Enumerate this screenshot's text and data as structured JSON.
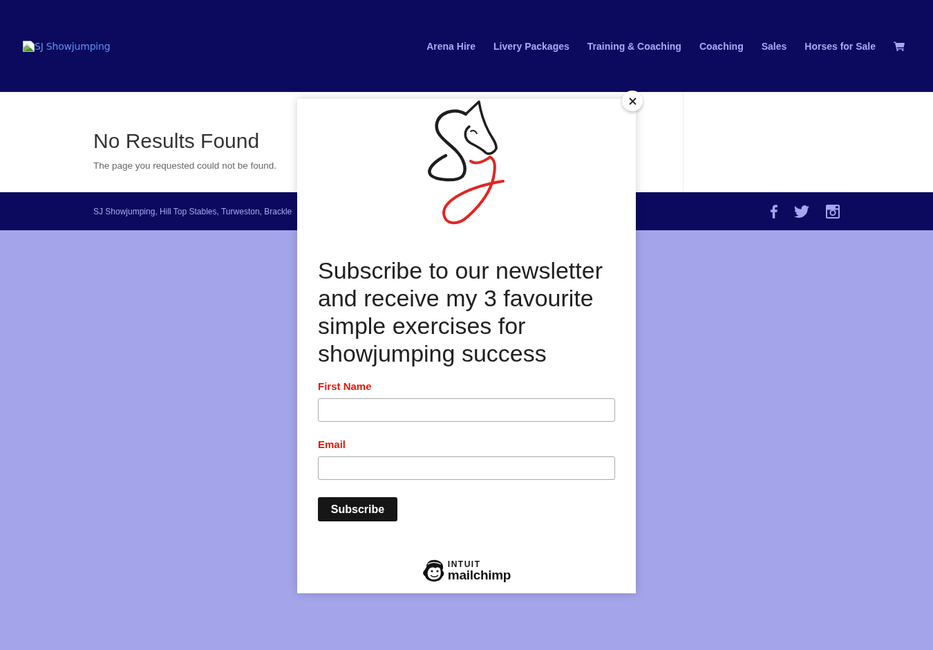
{
  "header": {
    "logo": {
      "alt_text": "SJ Showjumping"
    },
    "nav": [
      {
        "label": "Arena Hire"
      },
      {
        "label": "Livery Packages"
      },
      {
        "label": "Training & Coaching"
      },
      {
        "label": "Coaching"
      },
      {
        "label": "Sales"
      },
      {
        "label": "Horses for Sale"
      }
    ]
  },
  "content": {
    "title": "No Results Found",
    "message": "The page you requested could not be found."
  },
  "footer": {
    "address": "SJ Showjumping, Hill Top Stables, Turweston, Brackle",
    "social": [
      {
        "kind": "facebook"
      },
      {
        "kind": "twitter"
      },
      {
        "kind": "instagram"
      }
    ]
  },
  "popup": {
    "heading": "Subscribe to our newsletter and receive my 3 favourite simple exercises for showjumping success",
    "fields": [
      {
        "label": "First Name"
      },
      {
        "label": "Email"
      }
    ],
    "submit": "Subscribe",
    "brand": {
      "caption": "INTUIT",
      "name": "mailchimp"
    }
  }
}
